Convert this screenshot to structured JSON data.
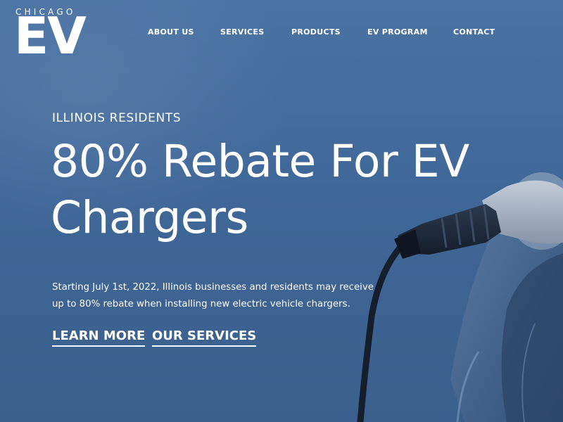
{
  "brand": {
    "small_text": "CHICAGO",
    "big_text": "EV"
  },
  "nav": {
    "items": [
      {
        "label": "ABOUT US"
      },
      {
        "label": "SERVICES"
      },
      {
        "label": "PRODUCTS"
      },
      {
        "label": "EV PROGRAM"
      },
      {
        "label": "CONTACT"
      }
    ]
  },
  "hero": {
    "eyebrow": "ILLINOIS RESIDENTS",
    "headline_line1": "80% Rebate For EV",
    "headline_line2": "Chargers",
    "description_line1": "Starting July 1st, 2022, Illinois businesses and residents may receive",
    "description_line2": "up to 80% rebate when installing new electric vehicle chargers.",
    "cta_primary": "LEARN MORE",
    "cta_secondary": "OUR SERVICES",
    "background_image": "ev-charging-plug-photo"
  },
  "colors": {
    "overlay": "#3f6797",
    "text": "#ffffff",
    "plug_dark": "#1e2a3a",
    "plug_light": "#a9b4c4"
  }
}
